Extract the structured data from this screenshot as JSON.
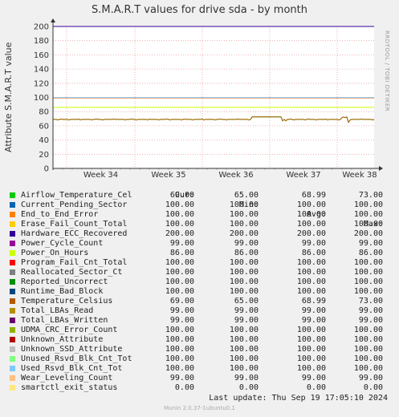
{
  "chart_data": {
    "type": "line",
    "title": "S.M.A.R.T values for drive sda - by month",
    "ylabel": "Attribute S.M.A.R.T value",
    "ylim": [
      0,
      200
    ],
    "yticks": [
      0,
      20,
      40,
      60,
      80,
      100,
      120,
      140,
      160,
      180,
      200
    ],
    "x_categories": [
      "Week 34",
      "Week 35",
      "Week 36",
      "Week 37",
      "Week 38"
    ],
    "grid": true,
    "legend_placement": "bottom",
    "columns": [
      "Cur:",
      "Min:",
      "Avg:",
      "Max:"
    ],
    "series": [
      {
        "name": "Airflow_Temperature_Cel",
        "color": "#00cc00",
        "cur": "69.00",
        "min": "65.00",
        "avg": "68.99",
        "max": "73.00",
        "level": 69
      },
      {
        "name": "Current_Pending_Sector",
        "color": "#0066b3",
        "cur": "100.00",
        "min": "100.00",
        "avg": "100.00",
        "max": "100.00",
        "level": 100
      },
      {
        "name": "End_to_End_Error",
        "color": "#ff8000",
        "cur": "100.00",
        "min": "100.00",
        "avg": "100.00",
        "max": "100.00",
        "level": 100
      },
      {
        "name": "Erase_Fail_Count_Total",
        "color": "#ffcc00",
        "cur": "100.00",
        "min": "100.00",
        "avg": "100.00",
        "max": "100.00",
        "level": 100
      },
      {
        "name": "Hardware_ECC_Recovered",
        "color": "#330099",
        "cur": "200.00",
        "min": "200.00",
        "avg": "200.00",
        "max": "200.00",
        "level": 200
      },
      {
        "name": "Power_Cycle_Count",
        "color": "#990099",
        "cur": "99.00",
        "min": "99.00",
        "avg": "99.00",
        "max": "99.00",
        "level": 99
      },
      {
        "name": "Power_On_Hours",
        "color": "#ccff00",
        "cur": "86.00",
        "min": "86.00",
        "avg": "86.00",
        "max": "86.00",
        "level": 86
      },
      {
        "name": "Program_Fail_Cnt_Total",
        "color": "#ff0000",
        "cur": "100.00",
        "min": "100.00",
        "avg": "100.00",
        "max": "100.00",
        "level": 100
      },
      {
        "name": "Reallocated_Sector_Ct",
        "color": "#808080",
        "cur": "100.00",
        "min": "100.00",
        "avg": "100.00",
        "max": "100.00",
        "level": 100
      },
      {
        "name": "Reported_Uncorrect",
        "color": "#008f00",
        "cur": "100.00",
        "min": "100.00",
        "avg": "100.00",
        "max": "100.00",
        "level": 100
      },
      {
        "name": "Runtime_Bad_Block",
        "color": "#00487d",
        "cur": "100.00",
        "min": "100.00",
        "avg": "100.00",
        "max": "100.00",
        "level": 100
      },
      {
        "name": "Temperature_Celsius",
        "color": "#b35a00",
        "cur": "69.00",
        "min": "65.00",
        "avg": "68.99",
        "max": "73.00",
        "level": 69
      },
      {
        "name": "Total_LBAs_Read",
        "color": "#b38f00",
        "cur": "99.00",
        "min": "99.00",
        "avg": "99.00",
        "max": "99.00",
        "level": 99
      },
      {
        "name": "Total_LBAs_Written",
        "color": "#6b006b",
        "cur": "99.00",
        "min": "99.00",
        "avg": "99.00",
        "max": "99.00",
        "level": 99
      },
      {
        "name": "UDMA_CRC_Error_Count",
        "color": "#8fb300",
        "cur": "100.00",
        "min": "100.00",
        "avg": "100.00",
        "max": "100.00",
        "level": 100
      },
      {
        "name": "Unknown_Attribute",
        "color": "#b30000",
        "cur": "100.00",
        "min": "100.00",
        "avg": "100.00",
        "max": "100.00",
        "level": 100
      },
      {
        "name": "Unknown_SSD_Attribute",
        "color": "#bebebe",
        "cur": "100.00",
        "min": "100.00",
        "avg": "100.00",
        "max": "100.00",
        "level": 100
      },
      {
        "name": "Unused_Rsvd_Blk_Cnt_Tot",
        "color": "#80ff80",
        "cur": "100.00",
        "min": "100.00",
        "avg": "100.00",
        "max": "100.00",
        "level": 100
      },
      {
        "name": "Used_Rsvd_Blk_Cnt_Tot",
        "color": "#80c9ff",
        "cur": "100.00",
        "min": "100.00",
        "avg": "100.00",
        "max": "100.00",
        "level": 100
      },
      {
        "name": "Wear_Leveling_Count",
        "color": "#ffc080",
        "cur": "99.00",
        "min": "99.00",
        "avg": "99.00",
        "max": "99.00",
        "level": 99
      },
      {
        "name": "smartctl_exit_status",
        "color": "#ffe680",
        "cur": "0.00",
        "min": "0.00",
        "avg": "0.00",
        "max": "0.00",
        "level": 0
      }
    ]
  },
  "side_text": "RRDTOOL / TOBI OETIKER",
  "last_update": "Last update: Thu Sep 19 17:05:10 2024",
  "footer": "Munin 2.0.37-1ubuntu0.1"
}
